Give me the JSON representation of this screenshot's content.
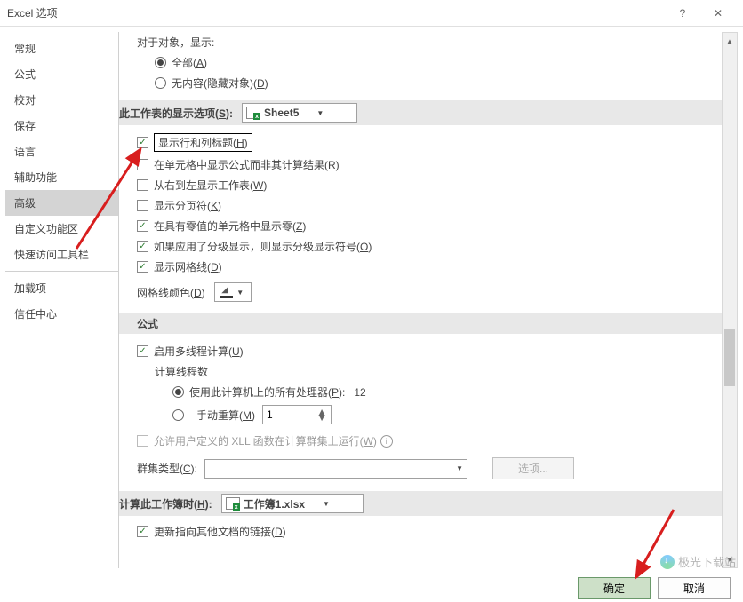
{
  "title": "Excel 选项",
  "titlebar": {
    "help": "?",
    "close": "✕"
  },
  "sidebar": {
    "items": [
      "常规",
      "公式",
      "校对",
      "保存",
      "语言",
      "辅助功能",
      "高级",
      "自定义功能区",
      "快速访问工具栏",
      "加载项",
      "信任中心"
    ],
    "selected": "高级"
  },
  "content": {
    "objectsHeader": "对于对象，显示:",
    "obj_all": "全部(A)",
    "obj_all_key": "A",
    "obj_none": "无内容(隐藏对象)(D)",
    "obj_none_key": "D",
    "worksheetSectionLabel": "此工作表的显示选项(S):",
    "worksheetCombo": "Sheet5",
    "ws_opts": {
      "showHeaders": "显示行和列标题(H)",
      "showFormulas": "在单元格中显示公式而非其计算结果(R)",
      "rtl": "从右到左显示工作表(W)",
      "pagebreaks": "显示分页符(K)",
      "zeros": "在具有零值的单元格中显示零(Z)",
      "outline": "如果应用了分级显示，则显示分级显示符号(O)",
      "gridlines": "显示网格线(D)"
    },
    "gridColorLabel": "网格线颜色(D)",
    "formulasHead": "公式",
    "multithread": "启用多线程计算(U)",
    "threadCountLabel": "计算线程数",
    "allProcessors": "使用此计算机上的所有处理器(P):",
    "processorCount": "12",
    "manual": "手动重算(M)",
    "manualValue": "1",
    "xllDisabled": "允许用户定义的 XLL 函数在计算群集上运行(W)",
    "clusterType": "群集类型(C):",
    "optionsBtn": "选项...",
    "wbSectionLabel": "计算此工作簿时(H):",
    "wbCombo": "工作簿1.xlsx",
    "updateLinks": "更新指向其他文档的链接(D)"
  },
  "footer": {
    "ok": "确定",
    "cancel": "取消"
  },
  "watermark": "极光下载站"
}
